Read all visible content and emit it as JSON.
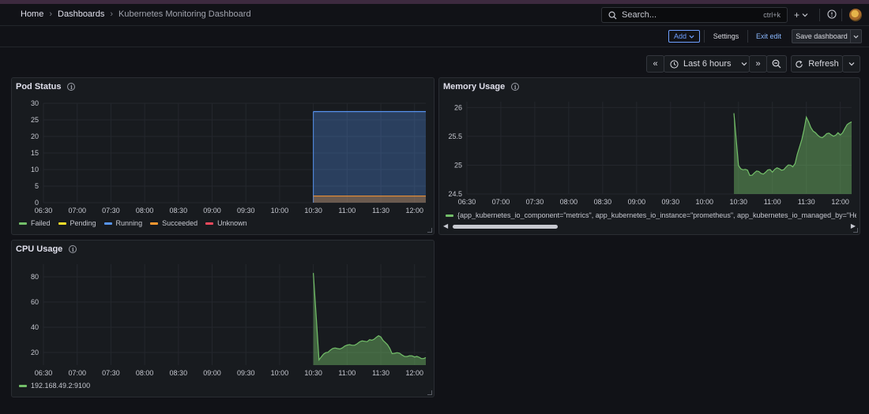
{
  "breadcrumb": {
    "home": "Home",
    "dashboards": "Dashboards",
    "current": "Kubernetes Monitoring Dashboard"
  },
  "search": {
    "placeholder": "Search...",
    "shortcut": "ctrl+k"
  },
  "toolbar": {
    "add_label": "Add",
    "settings_label": "Settings",
    "exit_edit_label": "Exit edit",
    "save_label": "Save dashboard"
  },
  "timepicker": {
    "range_label": "Last 6 hours",
    "refresh_label": "Refresh"
  },
  "colors": {
    "accent_blue": "#6e9fff",
    "green": "#73bf69",
    "yellow": "#fade2a",
    "blue": "#5794f2",
    "orange": "#ff9830",
    "red": "#f2495c"
  },
  "panels": {
    "pod_status": {
      "title": "Pod Status",
      "yticks": [
        "30",
        "25",
        "20",
        "15",
        "10",
        "5",
        "0"
      ],
      "xticks": [
        "06:30",
        "07:00",
        "07:30",
        "08:00",
        "08:30",
        "09:00",
        "09:30",
        "10:00",
        "10:30",
        "11:00",
        "11:30",
        "12:00"
      ],
      "legend": [
        {
          "name": "Failed",
          "color": "#73bf69"
        },
        {
          "name": "Pending",
          "color": "#fade2a"
        },
        {
          "name": "Running",
          "color": "#5794f2"
        },
        {
          "name": "Succeeded",
          "color": "#ff9830"
        },
        {
          "name": "Unknown",
          "color": "#f2495c"
        }
      ]
    },
    "memory": {
      "title": "Memory Usage",
      "yticks": [
        "26",
        "25.5",
        "25",
        "24.5"
      ],
      "xticks": [
        "06:30",
        "07:00",
        "07:30",
        "08:00",
        "08:30",
        "09:00",
        "09:30",
        "10:00",
        "10:30",
        "11:00",
        "11:30",
        "12:00"
      ],
      "legend_label": "{app_kubernetes_io_component=\"metrics\", app_kubernetes_io_instance=\"prometheus\", app_kubernetes_io_managed_by=\"Helm"
    },
    "cpu": {
      "title": "CPU Usage",
      "yticks": [
        "80",
        "60",
        "40",
        "20"
      ],
      "xticks": [
        "06:30",
        "07:00",
        "07:30",
        "08:00",
        "08:30",
        "09:00",
        "09:30",
        "10:00",
        "10:30",
        "11:00",
        "11:30",
        "12:00"
      ],
      "legend_label": "192.168.49.2:9100"
    }
  },
  "chart_data": [
    {
      "type": "area",
      "title": "Pod Status",
      "x": [
        "10:30",
        "12:10"
      ],
      "series": [
        {
          "name": "Running",
          "values": [
            27.5,
            27.5
          ]
        },
        {
          "name": "Succeeded",
          "values": [
            2,
            2
          ]
        },
        {
          "name": "Failed",
          "values": [
            0,
            0
          ]
        },
        {
          "name": "Pending",
          "values": [
            0,
            0
          ]
        },
        {
          "name": "Unknown",
          "values": [
            0,
            0
          ]
        }
      ],
      "ylim": [
        0,
        30
      ]
    },
    {
      "type": "area",
      "title": "Memory Usage",
      "x": [
        "10:26",
        "10:30",
        "10:40",
        "11:00",
        "11:20",
        "11:30",
        "11:40",
        "12:00",
        "12:10"
      ],
      "series": [
        {
          "name": "{app_kubernetes_io_component=\"metrics\", app_kubernetes_io_instance=\"prometheus\", app_kubernetes_io_managed_by=\"Helm",
          "values": [
            25.9,
            25.0,
            24.85,
            24.9,
            25.0,
            25.8,
            25.5,
            25.55,
            25.75
          ]
        }
      ],
      "ylim": [
        24.5,
        26.1
      ]
    },
    {
      "type": "area",
      "title": "CPU Usage",
      "x": [
        "10:30",
        "10:35",
        "10:45",
        "11:00",
        "11:20",
        "11:30",
        "11:40",
        "12:00",
        "12:10"
      ],
      "series": [
        {
          "name": "192.168.49.2:9100",
          "values": [
            83,
            15,
            22,
            25,
            30,
            33,
            20,
            16,
            16
          ]
        }
      ],
      "ylim": [
        10,
        90
      ]
    }
  ]
}
